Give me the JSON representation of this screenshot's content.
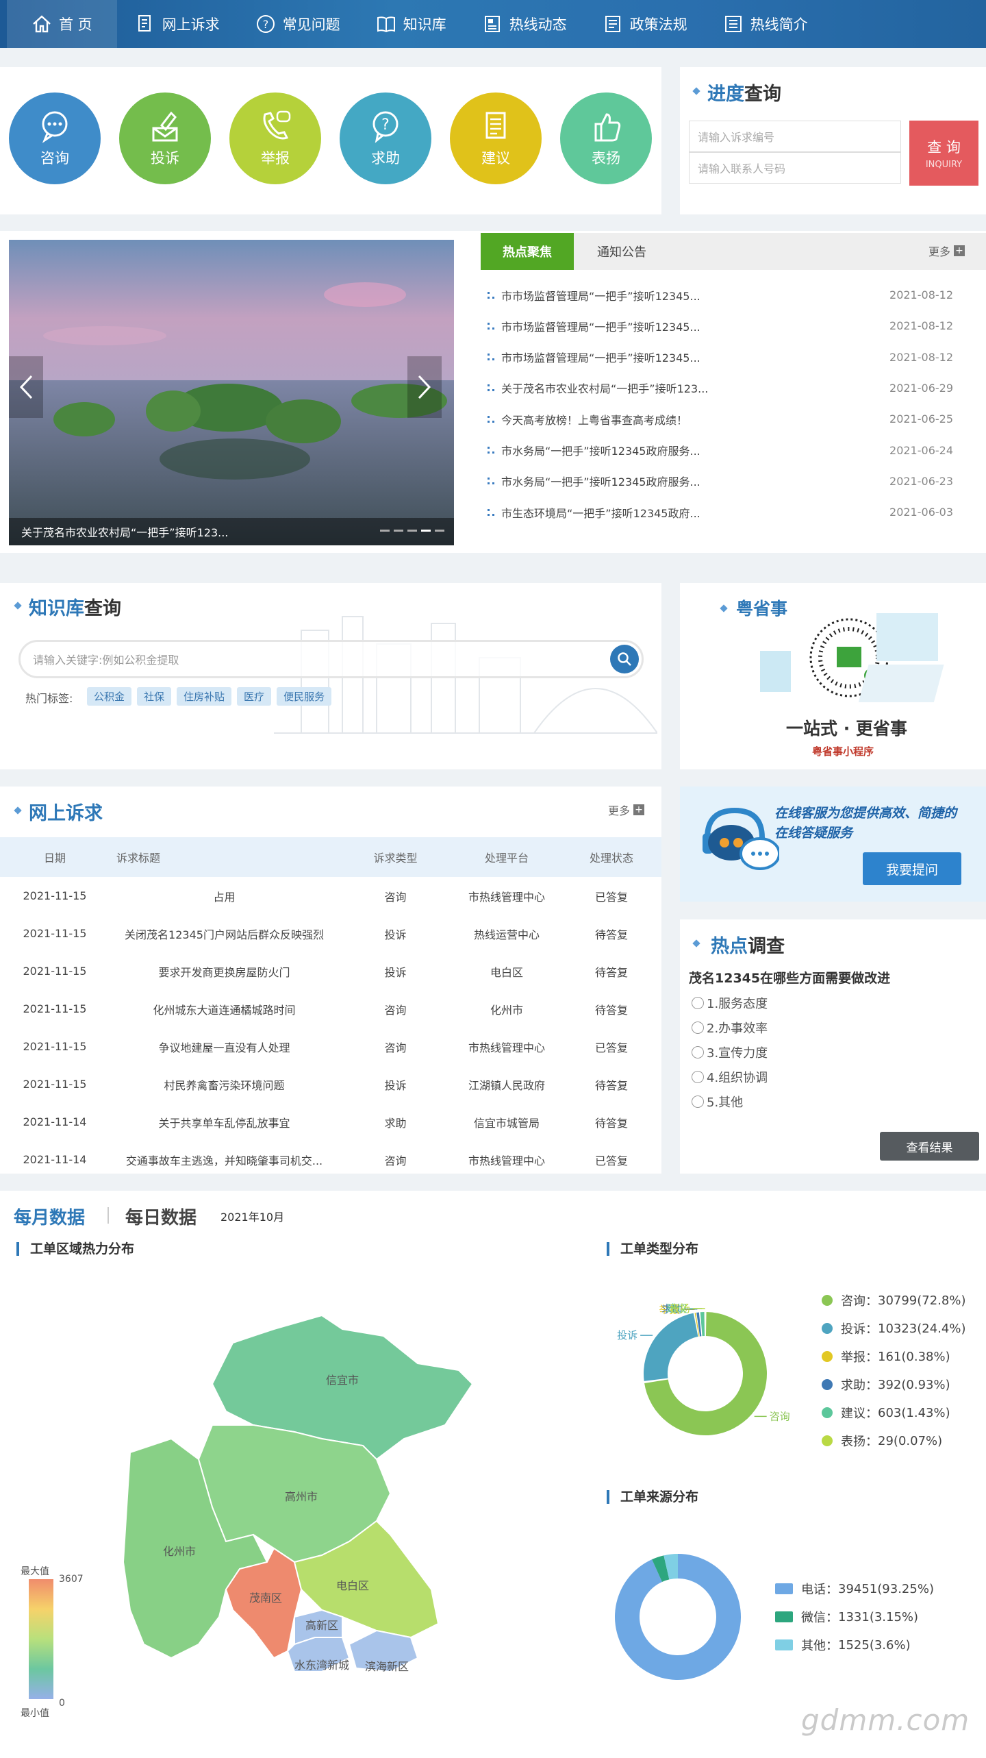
{
  "nav": [
    {
      "label": "首 页",
      "icon": "home-icon"
    },
    {
      "label": "网上诉求",
      "icon": "document-icon"
    },
    {
      "label": "常见问题",
      "icon": "question-icon"
    },
    {
      "label": "知识库",
      "icon": "book-icon"
    },
    {
      "label": "热线动态",
      "icon": "news-icon"
    },
    {
      "label": "政策法规",
      "icon": "policy-icon"
    },
    {
      "label": "热线简介",
      "icon": "intro-icon"
    }
  ],
  "services": [
    {
      "label": "咨询",
      "color": "#3f8cc9"
    },
    {
      "label": "投诉",
      "color": "#74bd4c"
    },
    {
      "label": "举报",
      "color": "#b5d13a"
    },
    {
      "label": "求助",
      "color": "#44a8c4"
    },
    {
      "label": "建议",
      "color": "#e0c21a"
    },
    {
      "label": "表扬",
      "color": "#5fc89a"
    }
  ],
  "progress": {
    "title_hl": "进度",
    "title": "查询",
    "code_placeholder": "请输入诉求编号",
    "phone_placeholder": "请输入联系人号码",
    "button": "查 询",
    "button_sub": "INQUIRY"
  },
  "carousel": {
    "caption": "关于茂名市农业农村局“一把手”接听123..."
  },
  "news": {
    "tab_active": "热点聚焦",
    "tab_other": "通知公告",
    "more": "更多",
    "items": [
      {
        "title": "市市场监督管理局“一把手”接听12345...",
        "date": "2021-08-12"
      },
      {
        "title": "市市场监督管理局“一把手”接听12345...",
        "date": "2021-08-12"
      },
      {
        "title": "市市场监督管理局“一把手”接听12345...",
        "date": "2021-08-12"
      },
      {
        "title": "关于茂名市农业农村局“一把手”接听123...",
        "date": "2021-06-29"
      },
      {
        "title": "今天高考放榜！上粤省事查高考成绩！",
        "date": "2021-06-25"
      },
      {
        "title": "市水务局“一把手”接听12345政府服务...",
        "date": "2021-06-24"
      },
      {
        "title": "市水务局“一把手”接听12345政府服务...",
        "date": "2021-06-23"
      },
      {
        "title": "市生态环境局“一把手”接听12345政府...",
        "date": "2021-06-03"
      }
    ]
  },
  "kb": {
    "title_hl": "知识库",
    "title": "查询",
    "placeholder": "请输入关键字:例如公积金提取",
    "tags_label": "热门标签:",
    "tags": [
      "公积金",
      "社保",
      "住房补贴",
      "医疗",
      "便民服务"
    ]
  },
  "yue": {
    "title_hl": "粤",
    "title": "省事",
    "slogan": "一站式 · 更省事",
    "sub": "粤省事小程序"
  },
  "appeals": {
    "title_hl": "网上",
    "title": "诉求",
    "more": "更多",
    "headers": [
      "日期",
      "诉求标题",
      "诉求类型",
      "处理平台",
      "处理状态"
    ],
    "rows": [
      [
        "2021-11-15",
        "占用",
        "咨询",
        "市热线管理中心",
        "已答复"
      ],
      [
        "2021-11-15",
        "关闭茂名12345门户网站后群众反映强烈",
        "投诉",
        "热线运营中心",
        "待答复"
      ],
      [
        "2021-11-15",
        "要求开发商更换房屋防火门",
        "投诉",
        "电白区",
        "待答复"
      ],
      [
        "2021-11-15",
        "化州城东大道连通橘城路时间",
        "咨询",
        "化州市",
        "待答复"
      ],
      [
        "2021-11-15",
        "争议地建屋一直没有人处理",
        "咨询",
        "市热线管理中心",
        "已答复"
      ],
      [
        "2021-11-15",
        "村民养禽畜污染环境问题",
        "投诉",
        "江湖镇人民政府",
        "待答复"
      ],
      [
        "2021-11-14",
        "关于共享单车乱停乱放事宜",
        "求助",
        "信宜市城管局",
        "待答复"
      ],
      [
        "2021-11-14",
        "交通事故车主逃逸，并知晓肇事司机交...",
        "咨询",
        "市热线管理中心",
        "已答复"
      ]
    ]
  },
  "service_ad": {
    "line1": "在线客服为您提供高效、简捷的",
    "line2": "在线答疑服务",
    "button": "我要提问"
  },
  "survey": {
    "title_hl": "热点",
    "title": "调查",
    "question": "茂名12345在哪些方面需要做改进",
    "options": [
      "1.服务态度",
      "2.办事效率",
      "3.宣传力度",
      "4.组织协调",
      "5.其他"
    ],
    "button": "查看结果"
  },
  "stats": {
    "tab_monthly": "每月数据",
    "tab_daily": "每日数据",
    "period": "2021年10月",
    "map_title": "工单区域热力分布",
    "type_title": "工单类型分布",
    "source_title": "工单来源分布",
    "legend_max": "最大值",
    "legend_min": "最小值",
    "legend_max_val": "3607",
    "legend_min_val": "0",
    "regions": [
      {
        "name": "信宜市",
        "color": "#74c99a"
      },
      {
        "name": "高州市",
        "color": "#8ed48c"
      },
      {
        "name": "化州市",
        "color": "#88d086"
      },
      {
        "name": "茂南区",
        "color": "#ee8a6e"
      },
      {
        "name": "电白区",
        "color": "#b7de6c"
      },
      {
        "name": "滨海新区",
        "color": "#a9c4ea"
      },
      {
        "name": "高新区",
        "color": "#a9c4ea"
      },
      {
        "name": "水东湾新城",
        "color": "#a9c4ea"
      }
    ],
    "types": [
      {
        "name": "咨询",
        "value": 30799,
        "pct": "72.8%",
        "color": "#8bc654"
      },
      {
        "name": "投诉",
        "value": 10323,
        "pct": "24.4%",
        "color": "#4ea4c0"
      },
      {
        "name": "举报",
        "value": 161,
        "pct": "0.38%",
        "color": "#e2c824"
      },
      {
        "name": "求助",
        "value": 392,
        "pct": "0.93%",
        "color": "#3f79b4"
      },
      {
        "name": "建议",
        "value": 603,
        "pct": "1.43%",
        "color": "#5cc79b"
      },
      {
        "name": "表扬",
        "value": 29,
        "pct": "0.07%",
        "color": "#b9d944"
      }
    ],
    "sources": [
      {
        "name": "电话",
        "value": 39451,
        "pct": "93.25%",
        "color": "#6ea8e4"
      },
      {
        "name": "微信",
        "value": 1331,
        "pct": "3.15%",
        "color": "#2da67e"
      },
      {
        "name": "其他",
        "value": 1525,
        "pct": "3.6%",
        "color": "#7fcfe4"
      }
    ]
  },
  "watermark": "gdmm.com"
}
